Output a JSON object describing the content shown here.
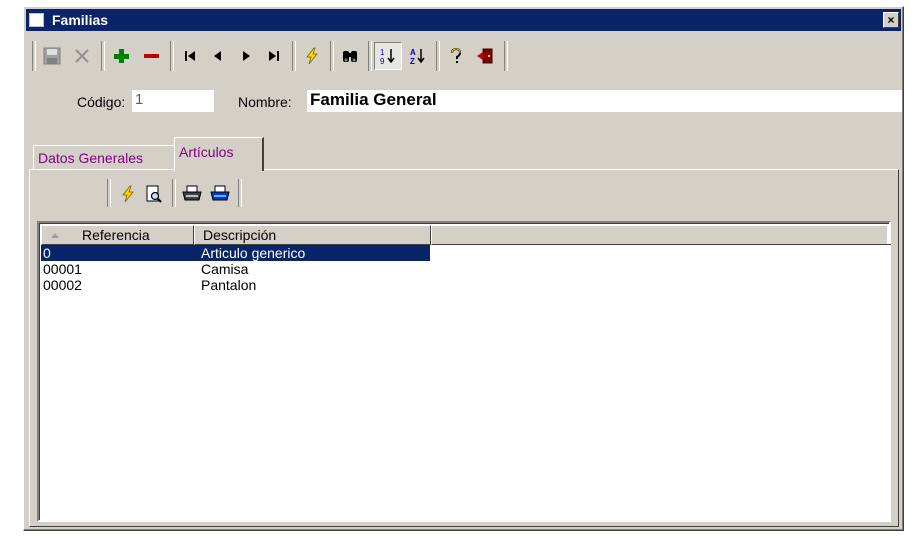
{
  "window": {
    "title": "Familias",
    "close_glyph": "×"
  },
  "toolbar": {
    "buttons": [
      {
        "name": "save-icon",
        "label": "Guardar"
      },
      {
        "name": "cancel-icon",
        "label": "Cancelar"
      },
      {
        "name": "add-icon",
        "label": "Añadir"
      },
      {
        "name": "delete-icon",
        "label": "Eliminar"
      },
      {
        "name": "first-record-icon",
        "label": "Primero"
      },
      {
        "name": "previous-record-icon",
        "label": "Anterior"
      },
      {
        "name": "next-record-icon",
        "label": "Siguiente"
      },
      {
        "name": "last-record-icon",
        "label": "Último"
      },
      {
        "name": "lightning-icon",
        "label": "Acción"
      },
      {
        "name": "binoculars-icon",
        "label": "Buscar"
      },
      {
        "name": "sort-numeric-icon",
        "label": "Orden numérico",
        "pressed": true
      },
      {
        "name": "sort-alpha-icon",
        "label": "Orden alfabético"
      },
      {
        "name": "help-icon",
        "label": "Ayuda"
      },
      {
        "name": "exit-icon",
        "label": "Salir"
      }
    ]
  },
  "form": {
    "codigo_label": "Código:",
    "codigo_value": "1",
    "nombre_label": "Nombre:",
    "nombre_value": "Familia General"
  },
  "tabs": [
    {
      "label": "Datos Generales",
      "active": false
    },
    {
      "label": "Artículos",
      "active": true
    }
  ],
  "articulos": {
    "columns": [
      "Referencia",
      "Descripción"
    ],
    "sort_column": "Referencia",
    "rows": [
      {
        "referencia": "0",
        "descripcion": "Articulo generico",
        "selected": true
      },
      {
        "referencia": "00001",
        "descripcion": "Camisa",
        "selected": false
      },
      {
        "referencia": "00002",
        "descripcion": "Pantalon",
        "selected": false
      }
    ]
  },
  "colors": {
    "titlebar": "#0a246a",
    "face": "#d4d0c8",
    "selection": "#0a246a",
    "tab_text": "#800080"
  }
}
